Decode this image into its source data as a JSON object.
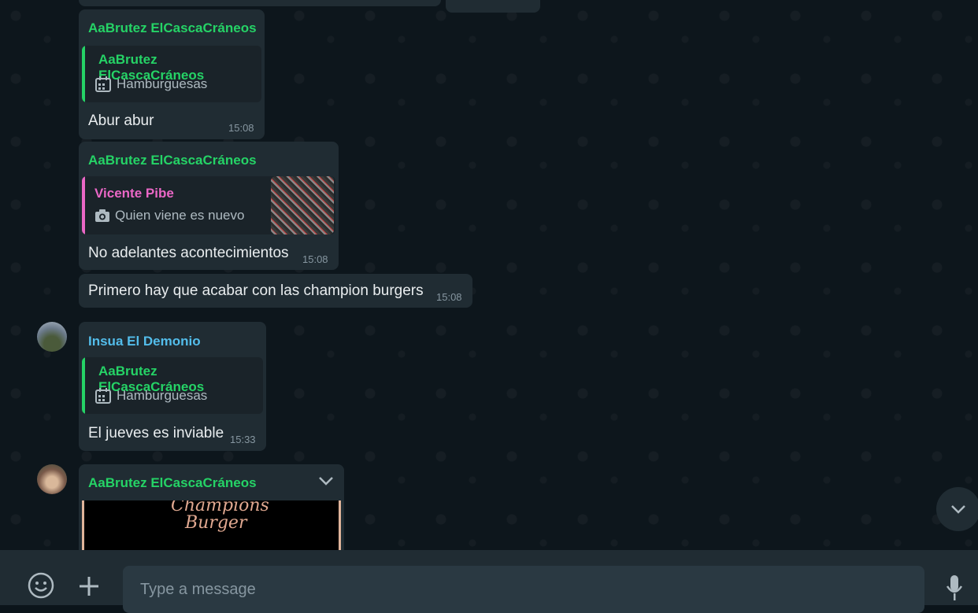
{
  "messages": [
    {
      "sender": "AaBrutez ElCascaCráneos",
      "quote": {
        "name": "AaBrutez ElCascaCráneos",
        "text": "Hamburguesas"
      },
      "text": "Abur abur",
      "time": "15:08"
    },
    {
      "sender": "AaBrutez ElCascaCráneos",
      "quote": {
        "name": "Vicente Pibe",
        "text": "Quien viene es nuevo"
      },
      "text": "No adelantes acontecimientos",
      "time": "15:08"
    },
    {
      "text": "Primero hay que acabar con las champion burgers",
      "time": "15:08"
    },
    {
      "sender": "Insua El Demonio",
      "quote": {
        "name": "AaBrutez ElCascaCráneos",
        "text": "Hamburguesas"
      },
      "text": "El jueves es inviable",
      "time": "15:33"
    },
    {
      "sender": "AaBrutez ElCascaCráneos",
      "image_text_1": "Champions",
      "image_text_2": "Burger"
    }
  ],
  "composer": {
    "placeholder": "Type a message"
  },
  "icons": {
    "emoji": "emoji-icon",
    "attach": "plus-icon",
    "mic": "microphone-icon",
    "scroll": "chevron-down-icon",
    "calendar": "calendar-icon",
    "camera": "camera-icon"
  },
  "colors": {
    "green": "#25d366",
    "pink": "#ea67c6",
    "blue": "#53bdeb"
  }
}
